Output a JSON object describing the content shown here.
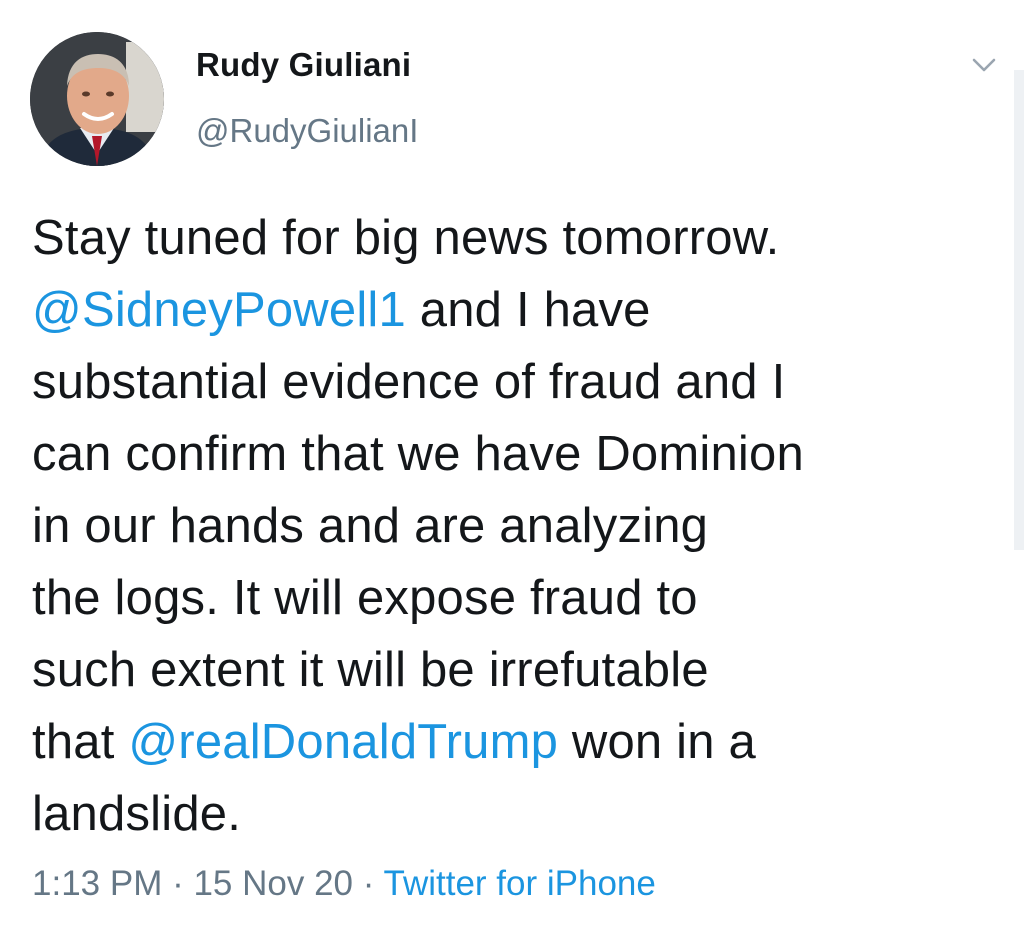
{
  "author": {
    "name": "Rudy Giuliani",
    "handle": "@RudyGiulianI",
    "avatar_icon": "profile-photo"
  },
  "caret_icon": "chevron-down-icon",
  "tweet": {
    "lines": [
      {
        "segments": [
          {
            "text": "Stay tuned for big news tomorrow.",
            "type": "text"
          }
        ]
      },
      {
        "segments": [
          {
            "text": "@SidneyPowell1",
            "type": "mention"
          },
          {
            "text": " and I have",
            "type": "text"
          }
        ]
      },
      {
        "segments": [
          {
            "text": "substantial evidence of fraud and I",
            "type": "text"
          }
        ]
      },
      {
        "segments": [
          {
            "text": "can confirm that we have Dominion",
            "type": "text"
          }
        ]
      },
      {
        "segments": [
          {
            "text": "in our hands and are analyzing",
            "type": "text"
          }
        ]
      },
      {
        "segments": [
          {
            "text": "the logs. It will expose fraud to",
            "type": "text"
          }
        ]
      },
      {
        "segments": [
          {
            "text": "such extent it will be irrefutable",
            "type": "text"
          }
        ]
      },
      {
        "segments": [
          {
            "text": "that ",
            "type": "text"
          },
          {
            "text": "@realDonaldTrump",
            "type": "mention"
          },
          {
            "text": " won in a",
            "type": "text"
          }
        ]
      },
      {
        "segments": [
          {
            "text": "landslide.",
            "type": "text"
          }
        ]
      }
    ]
  },
  "meta": {
    "time": "1:13 PM",
    "separator": " · ",
    "date": "15 Nov 20",
    "source": "Twitter for iPhone"
  },
  "colors": {
    "link": "#1b95e0",
    "secondary_text": "#657786",
    "primary_text": "#14171a"
  }
}
